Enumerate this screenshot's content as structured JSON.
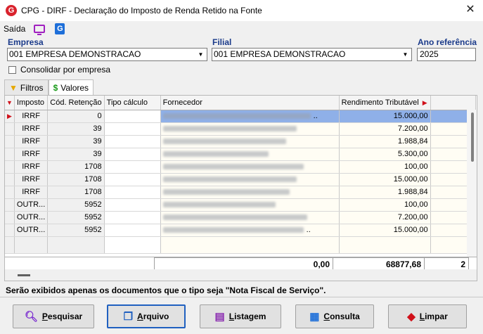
{
  "window": {
    "title": "CPG - DIRF - Declaração do Imposto de Renda Retido na Fonte",
    "logo_letter": "G",
    "close_glyph": "✕"
  },
  "menu": {
    "saida": "Saída",
    "g_letter": "G"
  },
  "form": {
    "empresa_label": "Empresa",
    "empresa_value": "001 EMPRESA DEMONSTRACAO",
    "filial_label": "Filial",
    "filial_value": "001 EMPRESA DEMONSTRACAO",
    "ano_label": "Ano referência",
    "ano_value": "2025",
    "consolidar_label": "Consolidar por empresa"
  },
  "tabs": [
    {
      "label": "Filtros",
      "icon": "filter-icon"
    },
    {
      "label": "Valores",
      "icon": "money-icon"
    }
  ],
  "grid": {
    "headers": [
      "Imposto",
      "Cód. Retenção",
      "Tipo cálculo",
      "Fornecedor",
      "Rendimento Tributável"
    ],
    "rows": [
      {
        "imposto": "IRRF",
        "cod": "0",
        "tipo": "",
        "rend": "15.000,00",
        "forn_suffix": ".."
      },
      {
        "imposto": "IRRF",
        "cod": "39",
        "tipo": "",
        "rend": "7.200,00",
        "forn_suffix": ""
      },
      {
        "imposto": "IRRF",
        "cod": "39",
        "tipo": "",
        "rend": "1.988,84",
        "forn_suffix": ""
      },
      {
        "imposto": "IRRF",
        "cod": "39",
        "tipo": "",
        "rend": "5.300,00",
        "forn_suffix": ""
      },
      {
        "imposto": "IRRF",
        "cod": "1708",
        "tipo": "",
        "rend": "100,00",
        "forn_suffix": ""
      },
      {
        "imposto": "IRRF",
        "cod": "1708",
        "tipo": "",
        "rend": "15.000,00",
        "forn_suffix": ""
      },
      {
        "imposto": "IRRF",
        "cod": "1708",
        "tipo": "",
        "rend": "1.988,84",
        "forn_suffix": ""
      },
      {
        "imposto": "OUTR...",
        "cod": "5952",
        "tipo": "",
        "rend": "100,00",
        "forn_suffix": ""
      },
      {
        "imposto": "OUTR...",
        "cod": "5952",
        "tipo": "",
        "rend": "7.200,00",
        "forn_suffix": ""
      },
      {
        "imposto": "OUTR...",
        "cod": "5952",
        "tipo": "",
        "rend": "15.000,00",
        "forn_suffix": ".."
      }
    ],
    "footer_forn": "0,00",
    "footer_rend": "68877,68",
    "footer_extra": "2"
  },
  "status": "Serão exibidos apenas os documentos que o tipo seja \"Nota Fiscal de Serviço\".",
  "buttons": {
    "pesquisar": {
      "mnemonic": "P",
      "rest": "esquisar"
    },
    "arquivo": {
      "mnemonic": "A",
      "rest": "rquivo"
    },
    "listagem": {
      "mnemonic": "L",
      "rest": "istagem"
    },
    "consulta": {
      "mnemonic": "C",
      "rest": "onsulta"
    },
    "limpar": {
      "mnemonic": "L",
      "rest": "impar"
    }
  }
}
